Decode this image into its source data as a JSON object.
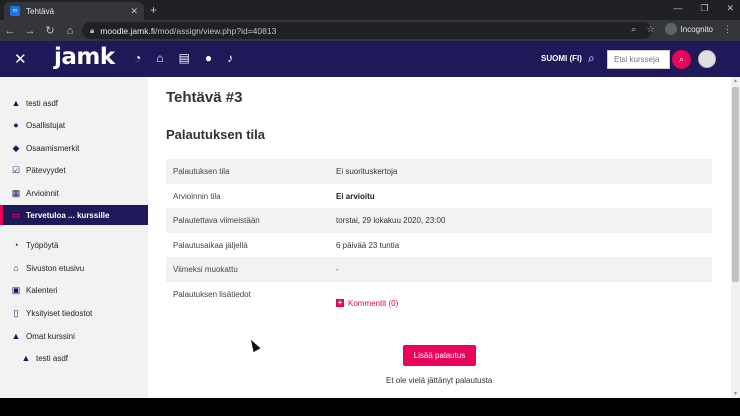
{
  "browser": {
    "tab_title": "Tehtävä",
    "tab_close": "✕",
    "new_tab": "+",
    "url_host": "moodle.jamk.fi",
    "url_path": "/mod/assign/view.php?id=40813",
    "incognito_label": "Incognito"
  },
  "header": {
    "logo": "jamk",
    "language": "SUOMI (FI)",
    "search_placeholder": "Etsi kursseja"
  },
  "sidebar": {
    "items": [
      {
        "label": "testi asdf",
        "icon": "graduation-cap-icon"
      },
      {
        "label": "Osallistujat",
        "icon": "users-icon"
      },
      {
        "label": "Osaamismerkit",
        "icon": "shield-icon"
      },
      {
        "label": "Pätevyydet",
        "icon": "check-square-icon"
      },
      {
        "label": "Arvioinnit",
        "icon": "table-icon"
      },
      {
        "label": "Tervetuloa ... kurssille",
        "icon": "folder-icon"
      },
      {
        "label": "Työpöytä",
        "icon": "dashboard-icon"
      },
      {
        "label": "Sivuston etusivu",
        "icon": "home-icon"
      },
      {
        "label": "Kalenteri",
        "icon": "calendar-icon"
      },
      {
        "label": "Yksityiset tiedostot",
        "icon": "file-icon"
      },
      {
        "label": "Omat kurssini",
        "icon": "graduation-cap-icon"
      },
      {
        "label": "testi asdf",
        "icon": "graduation-cap-icon"
      }
    ]
  },
  "main": {
    "title": "Tehtävä #3",
    "section_title": "Palautuksen tila",
    "rows": [
      {
        "key": "Palautuksen tila",
        "value": "Ei suorituskertoja"
      },
      {
        "key": "Arvioinnin tila",
        "value": "Ei arvioitu"
      },
      {
        "key": "Palautettava viimeistään",
        "value": "torstai, 29 lokakuu 2020, 23:00"
      },
      {
        "key": "Palautusaikaa jäljellä",
        "value": "6 päivää 23 tuntia"
      },
      {
        "key": "Viimeksi muokattu",
        "value": "-"
      },
      {
        "key": "Palautuksen lisätiedot",
        "value": "Kommentit (0)"
      }
    ],
    "submit_label": "Lisää palautus",
    "note": "Et ole vielä jättänyt palautusta"
  },
  "colors": {
    "brand": "#1f1959",
    "accent": "#e8045a"
  }
}
